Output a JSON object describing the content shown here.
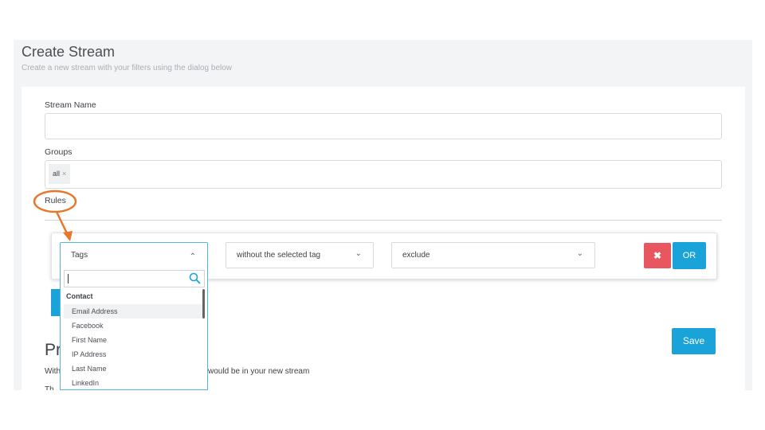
{
  "page": {
    "title": "Create Stream",
    "subtitle": "Create a new stream with your filters using the dialog below"
  },
  "form": {
    "stream_name_label": "Stream Name",
    "stream_name_value": "",
    "groups_label": "Groups",
    "groups_chip": "all",
    "groups_chip_remove": "×",
    "rules_label": "Rules"
  },
  "rule": {
    "field_select": "Tags",
    "field_chevron": "⌃",
    "condition_select": "without the selected tag",
    "condition_chevron": "⌄",
    "action_select": "exclude",
    "action_chevron": "⌄",
    "delete_label": "✖",
    "or_label": "OR"
  },
  "dropdown": {
    "search_value": "",
    "group": "Contact",
    "items": [
      {
        "label": "Email Address"
      },
      {
        "label": "Facebook"
      },
      {
        "label": "First Name"
      },
      {
        "label": "IP Address"
      },
      {
        "label": "Last Name"
      },
      {
        "label": "LinkedIn"
      }
    ],
    "highlighted_index": 0
  },
  "preview": {
    "heading_partial": "Pr",
    "text_left": "With",
    "text_right": "would be in your new stream",
    "text_line2": "Th"
  },
  "actions": {
    "save_label": "Save"
  },
  "colors": {
    "accent": "#1aa3d9",
    "danger": "#e85660",
    "annotation": "#e8762b"
  }
}
